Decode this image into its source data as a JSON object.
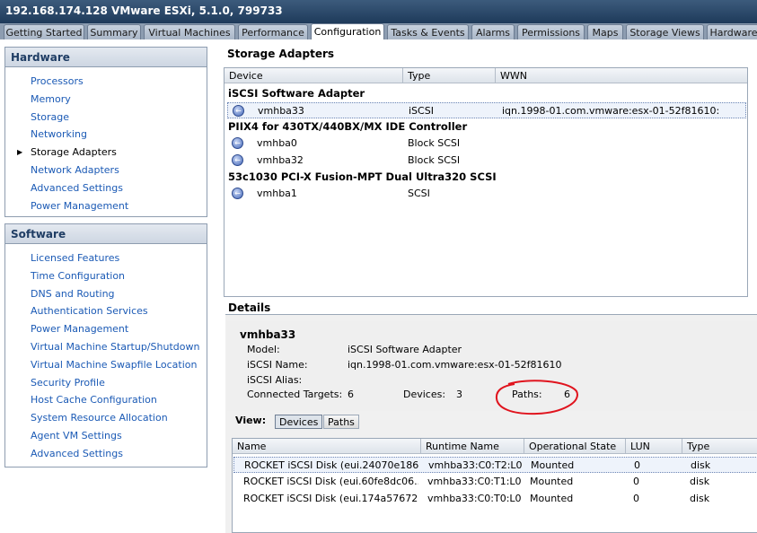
{
  "window": {
    "title": "192.168.174.128 VMware ESXi, 5.1.0, 799733"
  },
  "tabs": [
    {
      "label": "Getting Started"
    },
    {
      "label": "Summary"
    },
    {
      "label": "Virtual Machines"
    },
    {
      "label": "Performance"
    },
    {
      "label": "Configuration"
    },
    {
      "label": "Tasks & Events"
    },
    {
      "label": "Alarms"
    },
    {
      "label": "Permissions"
    },
    {
      "label": "Maps"
    },
    {
      "label": "Storage Views"
    },
    {
      "label": "Hardware"
    }
  ],
  "active_tab": "Configuration",
  "hardware": {
    "heading": "Hardware",
    "items": [
      "Processors",
      "Memory",
      "Storage",
      "Networking",
      "Storage Adapters",
      "Network Adapters",
      "Advanced Settings",
      "Power Management"
    ],
    "selected": "Storage Adapters"
  },
  "software": {
    "heading": "Software",
    "items": [
      "Licensed Features",
      "Time Configuration",
      "DNS and Routing",
      "Authentication Services",
      "Power Management",
      "Virtual Machine Startup/Shutdown",
      "Virtual Machine Swapfile Location",
      "Security Profile",
      "Host Cache Configuration",
      "System Resource Allocation",
      "Agent VM Settings",
      "Advanced Settings"
    ]
  },
  "storage_adapters": {
    "title": "Storage Adapters",
    "columns": [
      "Device",
      "Type",
      "WWN"
    ],
    "groups": [
      {
        "name": "iSCSI Software Adapter",
        "devices": [
          {
            "device": "vmhba33",
            "type": "iSCSI",
            "wwn": "iqn.1998-01.com.vmware:esx-01-52f81610:"
          }
        ]
      },
      {
        "name": "PIIX4 for 430TX/440BX/MX IDE Controller",
        "devices": [
          {
            "device": "vmhba0",
            "type": "Block SCSI",
            "wwn": ""
          },
          {
            "device": "vmhba32",
            "type": "Block SCSI",
            "wwn": ""
          }
        ]
      },
      {
        "name": "53c1030 PCI-X Fusion-MPT Dual Ultra320 SCSI",
        "devices": [
          {
            "device": "vmhba1",
            "type": "SCSI",
            "wwn": ""
          }
        ]
      }
    ],
    "selected_device": "vmhba33"
  },
  "details": {
    "title": "Details",
    "device": "vmhba33",
    "model_label": "Model:",
    "model_value": "iSCSI Software Adapter",
    "iscsi_name_label": "iSCSI Name:",
    "iscsi_name_value": "iqn.1998-01.com.vmware:esx-01-52f81610",
    "iscsi_alias_label": "iSCSI Alias:",
    "connected_targets_label": "Connected Targets:",
    "connected_targets_value": "6",
    "devices_label": "Devices:",
    "devices_value": "3",
    "paths_label": "Paths:",
    "paths_value": "6",
    "view_label": "View:",
    "view_buttons": [
      "Devices",
      "Paths"
    ],
    "active_view": "Devices",
    "annotation_color": "#e0141e"
  },
  "devices_table": {
    "columns": [
      "Name",
      "Runtime Name",
      "Operational State",
      "LUN",
      "Type"
    ],
    "rows": [
      {
        "name": "ROCKET iSCSI Disk (eui.24070e186...",
        "runtime": "vmhba33:C0:T2:L0",
        "state": "Mounted",
        "lun": "0",
        "type": "disk"
      },
      {
        "name": "ROCKET iSCSI Disk (eui.60fe8dc06...",
        "runtime": "vmhba33:C0:T1:L0",
        "state": "Mounted",
        "lun": "0",
        "type": "disk"
      },
      {
        "name": "ROCKET iSCSI Disk (eui.174a57672...",
        "runtime": "vmhba33:C0:T0:L0",
        "state": "Mounted",
        "lun": "0",
        "type": "disk"
      }
    ]
  }
}
